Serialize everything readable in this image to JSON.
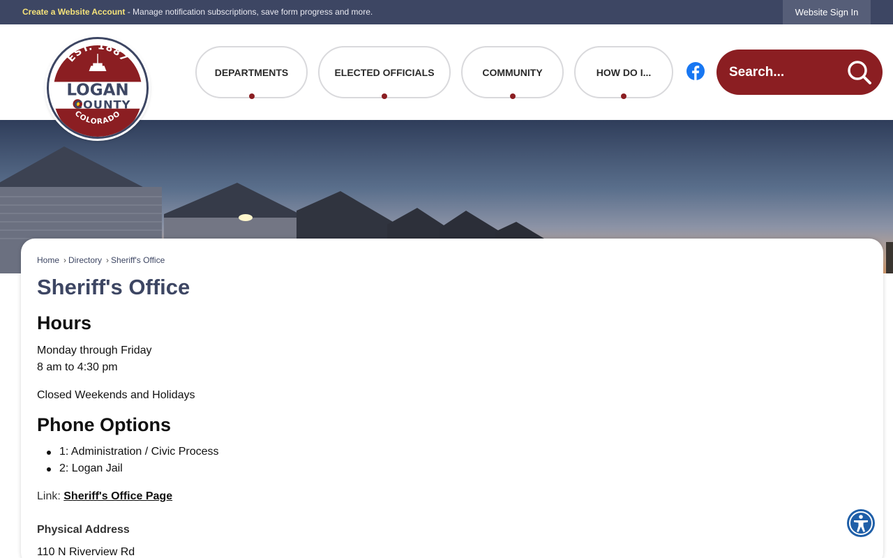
{
  "topbar": {
    "create_account": "Create a Website Account",
    "promo_text": " - Manage notification subscriptions, save form progress and more.",
    "signin": "Website Sign In"
  },
  "logo": {
    "est": "EST. 1887",
    "line1": "LOGAN",
    "line2": "COUNTY",
    "state": "COLORADO"
  },
  "nav": [
    {
      "label": "DEPARTMENTS"
    },
    {
      "label": "ELECTED OFFICIALS"
    },
    {
      "label": "COMMUNITY"
    },
    {
      "label": "HOW DO I..."
    }
  ],
  "search": {
    "placeholder": "Search..."
  },
  "colors": {
    "brand_navy": "#3d4663",
    "brand_red": "#8b1e22",
    "promo_yellow": "#f5e27a"
  },
  "icons": [
    "facebook-icon",
    "search-icon",
    "accessibility-icon"
  ],
  "breadcrumb": [
    "Home",
    "Directory",
    "Sheriff's Office"
  ],
  "page_title": "Sheriff's Office",
  "hours": {
    "heading": "Hours",
    "days": "Monday through Friday",
    "time": "8 am to 4:30 pm",
    "closed": "Closed Weekends and Holidays"
  },
  "phone": {
    "heading": "Phone Options",
    "options": [
      "1: Administration / Civic Process",
      "2: Logan Jail"
    ]
  },
  "link": {
    "label": "Link:",
    "text": "Sheriff's Office Page"
  },
  "address": {
    "heading": "Physical Address",
    "line1": "110 N Riverview Rd"
  }
}
